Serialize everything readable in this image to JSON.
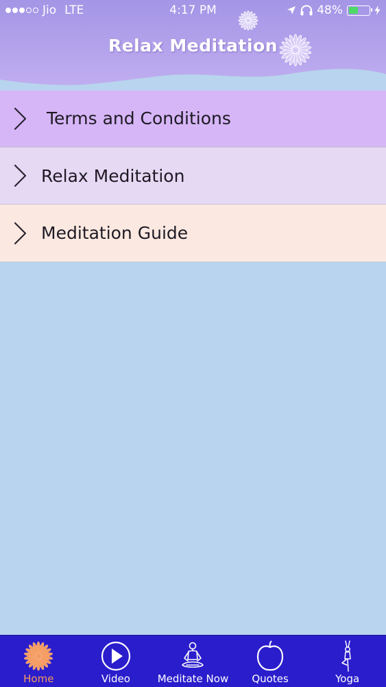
{
  "status_bar": {
    "carrier": "Jio",
    "network": "LTE",
    "time": "4:17 PM",
    "battery": "48%",
    "battery_level": 0.48,
    "signal_bars_on": 3,
    "signal_bars_total": 5
  },
  "header": {
    "title": "Relax Meditation"
  },
  "menu": {
    "items": [
      {
        "label": "Terms and Conditions",
        "icon": "chevron-right-icon"
      },
      {
        "label": "Relax Meditation",
        "icon": "chevron-right-icon"
      },
      {
        "label": "Meditation Guide",
        "icon": "chevron-right-icon"
      }
    ]
  },
  "tabbar": {
    "active_index": 0,
    "tabs": [
      {
        "label": "Home",
        "icon": "flower-icon"
      },
      {
        "label": "Video",
        "icon": "play-icon"
      },
      {
        "label": "Meditate Now",
        "icon": "meditation-figure-icon"
      },
      {
        "label": "Quotes",
        "icon": "apple-icon"
      },
      {
        "label": "Yoga",
        "icon": "yoga-tree-pose-icon"
      }
    ]
  },
  "colors": {
    "header_top": "#a89ae6",
    "background": "#b8d4ee",
    "tabbar": "#2a1dcc",
    "active_tab": "#f59a5f",
    "menu_item_1": "#d6b6f7",
    "menu_item_2": "#e6d9f4",
    "menu_item_3": "#fbe9e1"
  }
}
